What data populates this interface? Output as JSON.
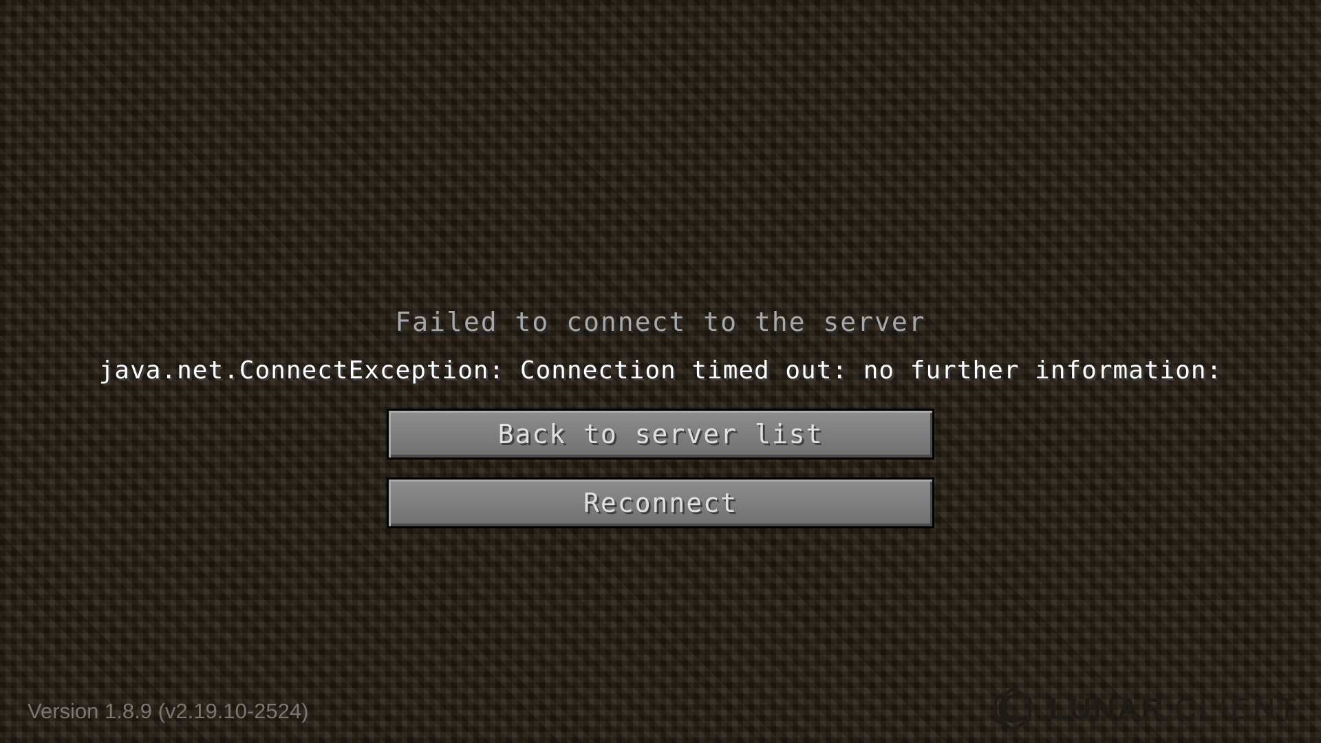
{
  "screen": {
    "title": "Failed to connect to the server",
    "reason": "java.net.ConnectException: Connection timed out: no further information:"
  },
  "buttons": {
    "back_label": "Back to server list",
    "reconnect_label": "Reconnect"
  },
  "footer": {
    "version": "Version 1.8.9 (v2.19.10-2524)",
    "brand_bold": "LUNAR",
    "brand_light": "CLIENT",
    "brand_icon": "lunar-moon-icon"
  },
  "colors": {
    "background": "#2b2219",
    "button": "#7f7f7f",
    "title_text": "#a8a8a8",
    "reason_text": "#ffffff"
  }
}
